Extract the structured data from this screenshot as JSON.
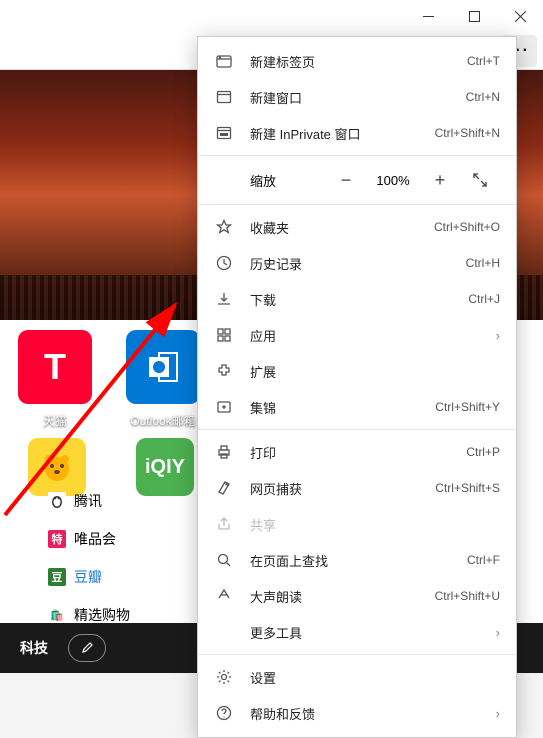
{
  "window": {
    "minimize": "—",
    "maximize": "□",
    "close": "✕"
  },
  "menu": {
    "new_tab": "新建标签页",
    "new_tab_sc": "Ctrl+T",
    "new_window": "新建窗口",
    "new_window_sc": "Ctrl+N",
    "new_inprivate": "新建 InPrivate 窗口",
    "new_inprivate_sc": "Ctrl+Shift+N",
    "zoom_label": "缩放",
    "zoom_pct": "100%",
    "favorites": "收藏夹",
    "favorites_sc": "Ctrl+Shift+O",
    "history": "历史记录",
    "history_sc": "Ctrl+H",
    "downloads": "下载",
    "downloads_sc": "Ctrl+J",
    "apps": "应用",
    "extensions": "扩展",
    "collections": "集锦",
    "collections_sc": "Ctrl+Shift+Y",
    "print": "打印",
    "print_sc": "Ctrl+P",
    "capture": "网页捕获",
    "capture_sc": "Ctrl+Shift+S",
    "share": "共享",
    "find": "在页面上查找",
    "find_sc": "Ctrl+F",
    "read": "大声朗读",
    "read_sc": "Ctrl+Shift+U",
    "more_tools": "更多工具",
    "settings": "设置",
    "help": "帮助和反馈"
  },
  "tiles": {
    "tmall": "天猫",
    "outlook": "Outlook邮箱"
  },
  "links": {
    "tencent": "腾讯",
    "vip": "唯品会",
    "douban": "豆瓣",
    "shopping": "精选购物",
    "vip_badge": "特",
    "douban_badge": "豆"
  },
  "bottom": {
    "tech": "科技"
  }
}
